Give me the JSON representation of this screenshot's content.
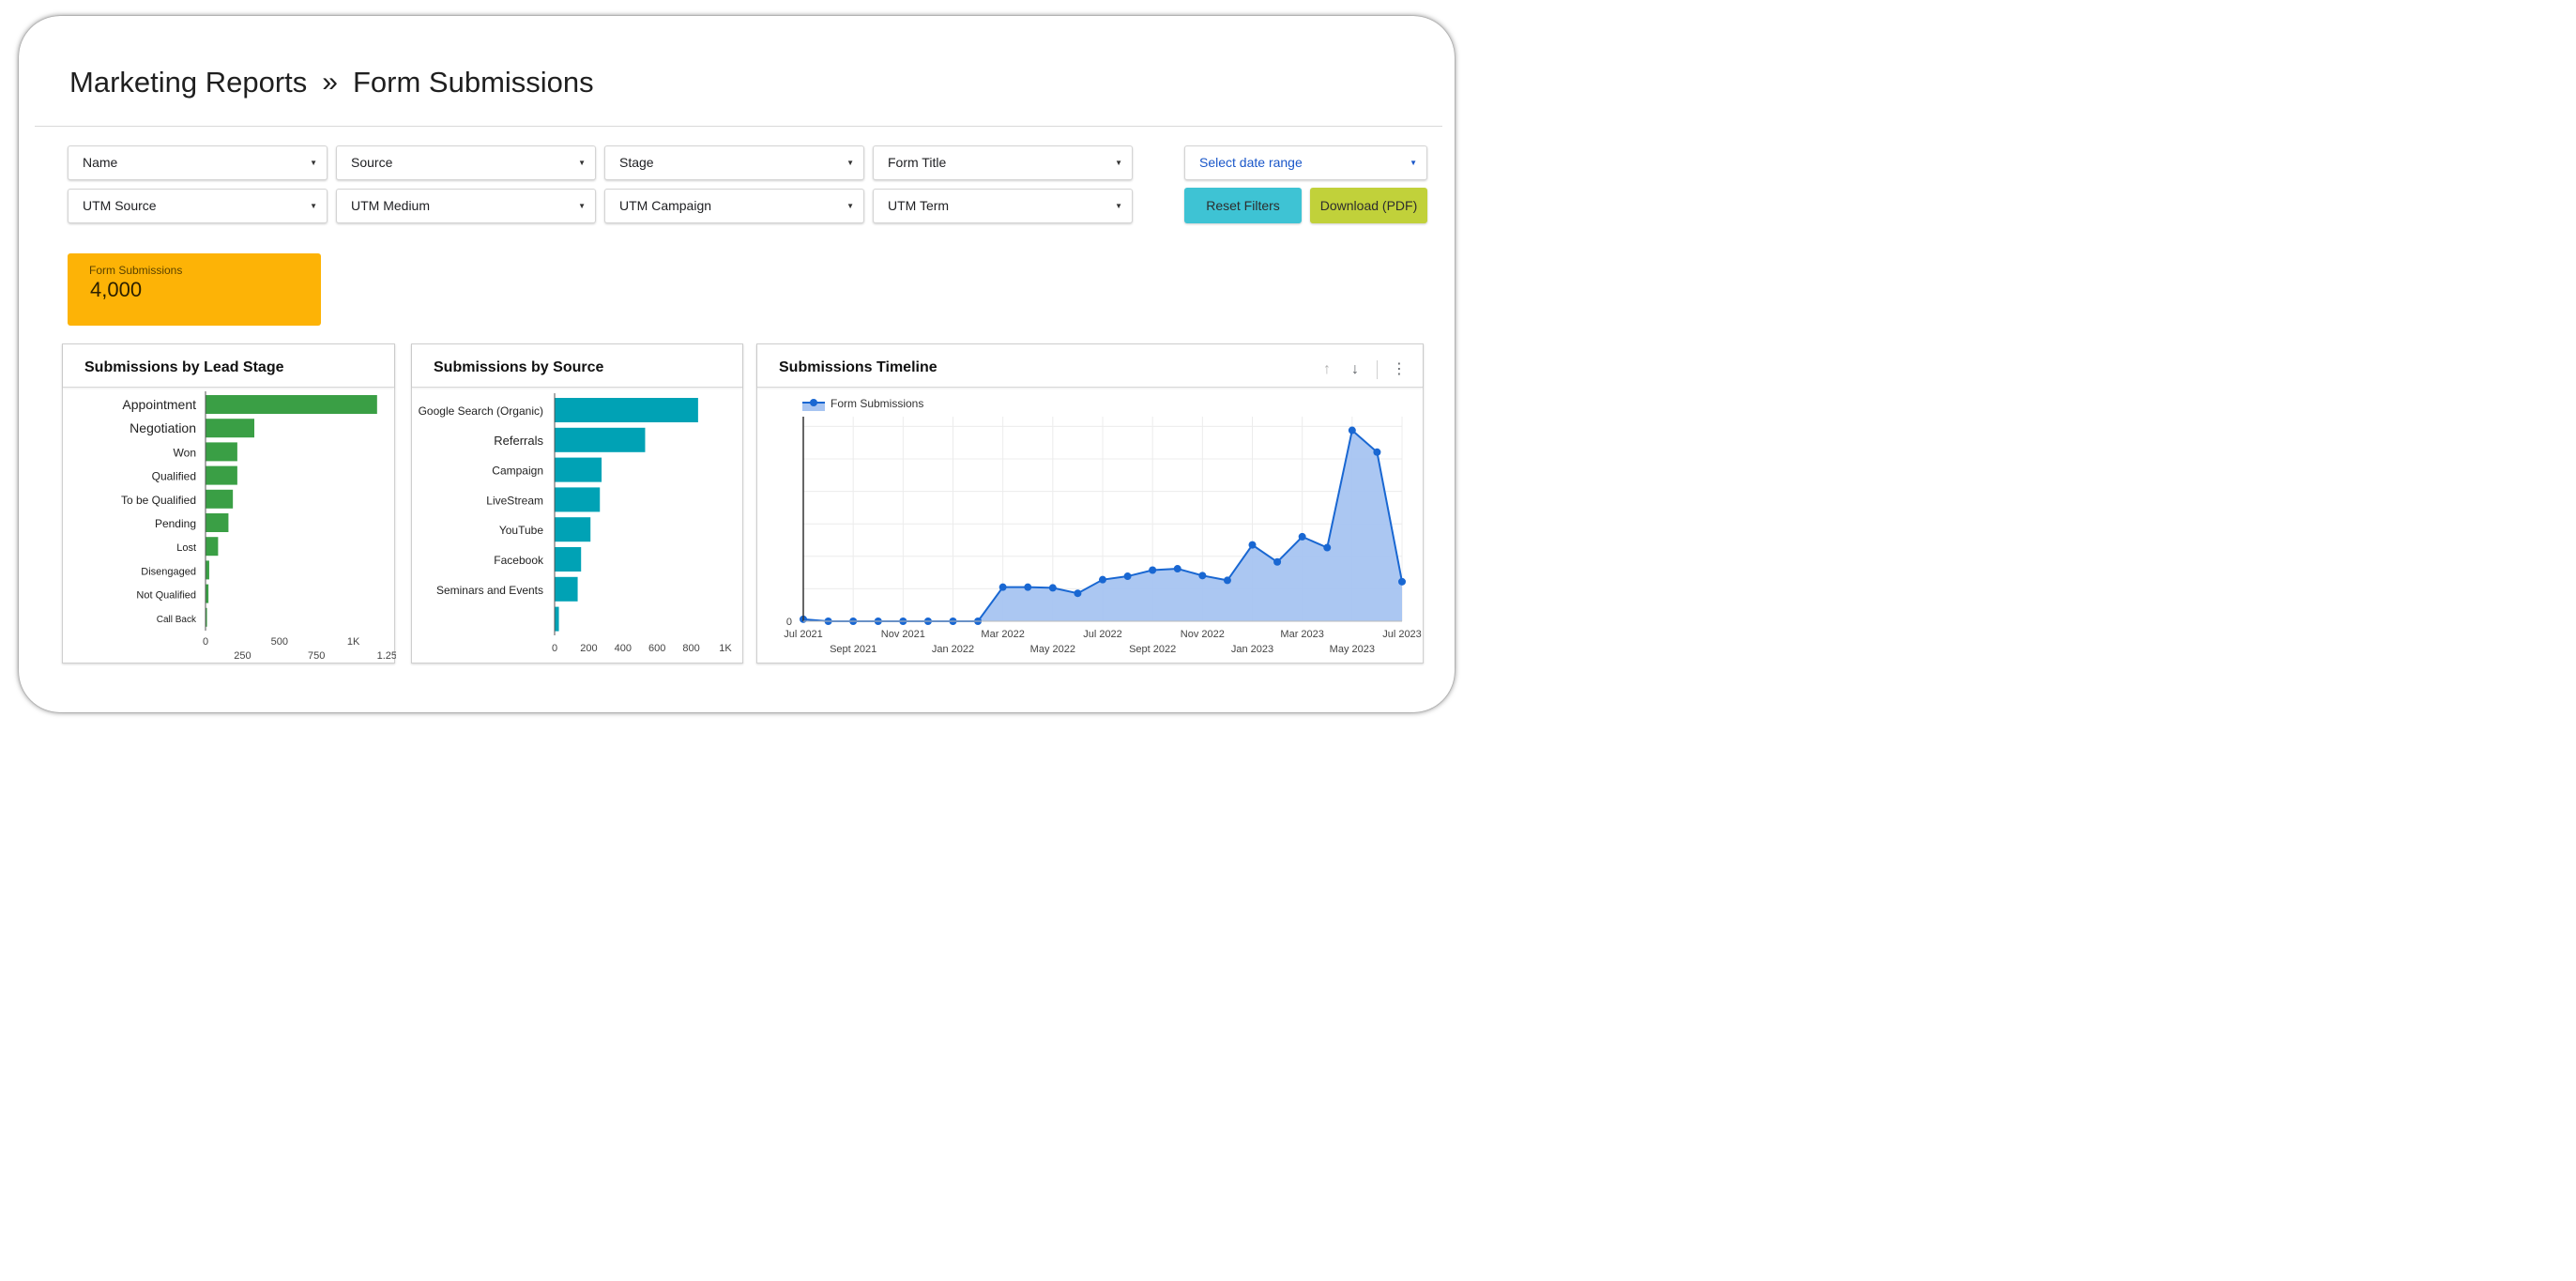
{
  "breadcrumb": {
    "parent": "Marketing Reports",
    "separator": "»",
    "current": "Form Submissions"
  },
  "filters": {
    "row1": [
      "Name",
      "Source",
      "Stage",
      "Form Title"
    ],
    "row2": [
      "UTM Source",
      "UTM Medium",
      "UTM Campaign",
      "UTM Term"
    ],
    "date_range": "Select date range"
  },
  "buttons": {
    "reset": "Reset Filters",
    "download": "Download (PDF)"
  },
  "kpi": {
    "label": "Form Submissions",
    "value": "4,000",
    "color": "#fdb306"
  },
  "colors": {
    "lead_stage": "#3a9f45",
    "source": "#00a2b5",
    "timeline_line": "#1967d2",
    "timeline_fill": "#a7c4f1"
  },
  "chart_data": [
    {
      "type": "bar",
      "title": "Submissions by Lead Stage",
      "orientation": "horizontal",
      "categories": [
        "Appointment",
        "Negotiation",
        "Won",
        "Qualified",
        "To be Qualified",
        "Pending",
        "Lost",
        "Disengaged",
        "Not Qualified",
        "Call Back"
      ],
      "values": [
        1160,
        330,
        215,
        215,
        185,
        155,
        85,
        25,
        20,
        10
      ],
      "xlim": [
        0,
        1250
      ],
      "xticks": [
        "0",
        "250",
        "500",
        "750",
        "1K",
        "1.25K"
      ],
      "xtick_values": [
        0,
        250,
        500,
        750,
        1000,
        1250
      ]
    },
    {
      "type": "bar",
      "title": "Submissions by Source",
      "orientation": "horizontal",
      "categories": [
        "Google Search (Organic)",
        "Referrals",
        "Campaign",
        "LiveStream",
        "YouTube",
        "Facebook",
        "Seminars and Events",
        ""
      ],
      "values": [
        840,
        530,
        275,
        265,
        210,
        155,
        135,
        25
      ],
      "xlim": [
        0,
        1000
      ],
      "xticks": [
        "0",
        "200",
        "400",
        "600",
        "800",
        "1K"
      ],
      "xtick_values": [
        0,
        200,
        400,
        600,
        800,
        1000
      ]
    },
    {
      "type": "area",
      "title": "Submissions Timeline",
      "legend": [
        "Form Submissions"
      ],
      "x": [
        "Jul 2021",
        "Aug 2021",
        "Sept 2021",
        "Oct 2021",
        "Nov 2021",
        "Dec 2021",
        "Jan 2022",
        "Feb 2022",
        "Mar 2022",
        "Apr 2022",
        "May 2022",
        "Jun 2022",
        "Jul 2022",
        "Aug 2022",
        "Sept 2022",
        "Oct 2022",
        "Nov 2022",
        "Dec 2022",
        "Jan 2023",
        "Feb 2023",
        "Mar 2023",
        "Apr 2023",
        "May 2023",
        "Jun 2023",
        "Jul 2023"
      ],
      "values": [
        3,
        0,
        0,
        0,
        0,
        0,
        0,
        0,
        50,
        50,
        49,
        41,
        61,
        66,
        75,
        77,
        67,
        60,
        112,
        87,
        124,
        108,
        280,
        248,
        58
      ],
      "ylim": [
        0,
        300
      ],
      "ytick_labels": [
        "0"
      ],
      "xticks_top": [
        "Jul 2021",
        "Nov 2021",
        "Mar 2022",
        "Jul 2022",
        "Nov 2022",
        "Mar 2023",
        "Jul 2023"
      ],
      "xticks_bottom": [
        "Sept 2021",
        "Jan 2022",
        "May 2022",
        "Sept 2022",
        "Jan 2023",
        "May 2023"
      ]
    }
  ]
}
